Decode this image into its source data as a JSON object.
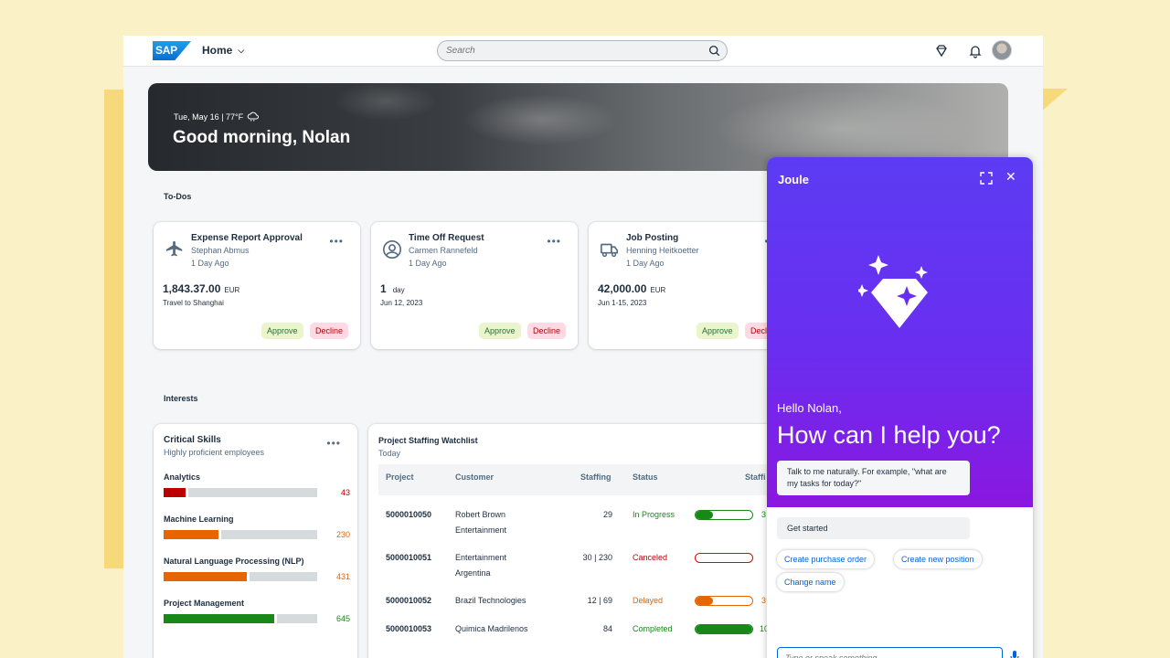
{
  "shell": {
    "logo": "SAP",
    "home_label": "Home",
    "search_placeholder": "Search"
  },
  "hero": {
    "date_weather": "Tue, May 16 | 77°F",
    "greeting": "Good morning, Nolan"
  },
  "todos": {
    "title": "To-Dos",
    "items": [
      {
        "title": "Expense Report Approval",
        "person": "Stephan Abmus",
        "time": "1 Day Ago",
        "amount": "1,843.37.00",
        "unit": "EUR",
        "sub": "Travel to Shanghai",
        "approve": "Approve",
        "decline": "Decline",
        "icon": "airplane-icon"
      },
      {
        "title": "Time Off Request",
        "person": "Carmen Rannefeld",
        "time": "1 Day Ago",
        "amount": "1",
        "unit": "day",
        "sub": "Jun 12, 2023",
        "approve": "Approve",
        "decline": "Decline",
        "icon": "person-icon"
      },
      {
        "title": "Job Posting",
        "person": "Henning Heitkoetter",
        "time": "1 Day Ago",
        "amount": "42,000.00",
        "unit": "EUR",
        "sub": "Jun 1-15, 2023",
        "approve": "Approve",
        "decline": "Decline",
        "icon": "truck-icon"
      }
    ]
  },
  "interests": {
    "title": "Interests",
    "skills": {
      "title": "Critical Skills",
      "subtitle": "Highly proficient employees",
      "items": [
        {
          "name": "Analytics",
          "value": "43",
          "fraction": 0.14,
          "color": "#bb0000"
        },
        {
          "name": "Machine Learning",
          "value": "230",
          "fraction": 0.36,
          "color": "#e76500"
        },
        {
          "name": "Natural Language Processing (NLP)",
          "value": "431",
          "fraction": 0.54,
          "color": "#e76500"
        },
        {
          "name": "Project Management",
          "value": "645",
          "fraction": 0.72,
          "color": "#188918"
        }
      ]
    },
    "watchlist": {
      "title": "Project Staffing Watchlist",
      "subtitle": "Today",
      "columns": [
        "Project",
        "Customer",
        "Staffing",
        "Status",
        "Staffi"
      ],
      "rows": [
        {
          "project": "5000010050",
          "customer": "Robert Brown Entertainment",
          "staffing": "29",
          "status": "In Progress",
          "status_color": "#188918",
          "fill": 0.3,
          "bar_color": "#188918",
          "extra": "3"
        },
        {
          "project": "5000010051",
          "customer": "Entertainment Argentina",
          "staffing": "30 | 230",
          "status": "Canceled",
          "status_color": "#aa0808",
          "fill": 0,
          "bar_color": "#d20a0a",
          "extra": ""
        },
        {
          "project": "5000010052",
          "customer": "Brazil Technologies",
          "staffing": "12 | 69",
          "status": "Delayed",
          "status_color": "#e76500",
          "fill": 0.3,
          "bar_color": "#e76500",
          "extra": "3"
        },
        {
          "project": "5000010053",
          "customer": "Quimica Madrilenos",
          "staffing": "84",
          "status": "Completed",
          "status_color": "#188918",
          "fill": 1.0,
          "bar_color": "#188918",
          "extra": "10"
        }
      ]
    }
  },
  "joule": {
    "title": "Joule",
    "hello": "Hello Nolan,",
    "help": "How can I help you?",
    "hint": "Talk to me naturally. For example, \"what are my tasks for today?\"",
    "get_started": "Get started",
    "chips": [
      "Create purchase order",
      "Create new position",
      "Change name"
    ],
    "input_placeholder": "Type or speak something..."
  }
}
